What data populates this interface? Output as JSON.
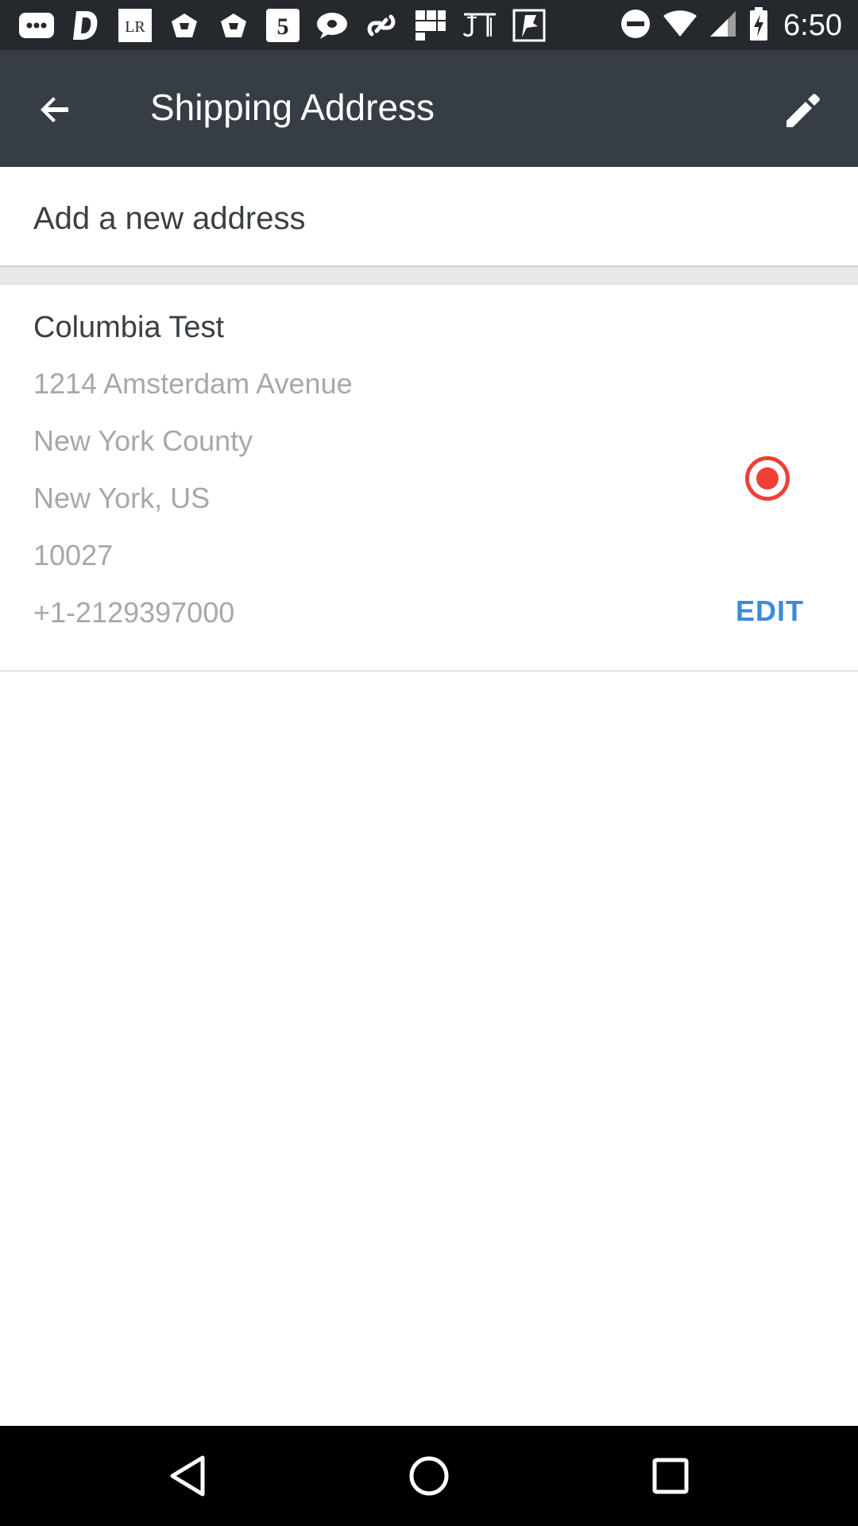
{
  "status_bar": {
    "time": "6:50",
    "notification_icons": [
      "messages-icon",
      "d-app-icon",
      "lr-app-icon",
      "shopping-bag-icon",
      "shopping-bag-icon",
      "5-app-icon",
      "chat-bubble-icon",
      "link-icon",
      "grid-app-icon",
      "jt-app-icon",
      "flag-app-icon"
    ],
    "lr_text": "LR",
    "five_text": "5",
    "system_icons": [
      "do-not-disturb-icon",
      "wifi-icon",
      "cell-signal-icon",
      "battery-charging-icon"
    ]
  },
  "app_bar": {
    "title": "Shipping Address",
    "background": "#373d45"
  },
  "add_address": {
    "label": "Add a new address"
  },
  "addresses": [
    {
      "name": "Columbia Test",
      "street": "1214 Amsterdam Avenue",
      "county": "New York County",
      "state_country": "New York, US",
      "zip": "10027",
      "phone": "+1-2129397000",
      "selected": true,
      "edit_label": "EDIT"
    }
  ],
  "colors": {
    "accent_radio": "#ee4036",
    "link_blue": "#3d8bd9",
    "secondary_text": "#a5a8ad"
  },
  "nav_bar": {
    "buttons": [
      "back-triangle-icon",
      "home-circle-icon",
      "recents-square-icon"
    ]
  }
}
